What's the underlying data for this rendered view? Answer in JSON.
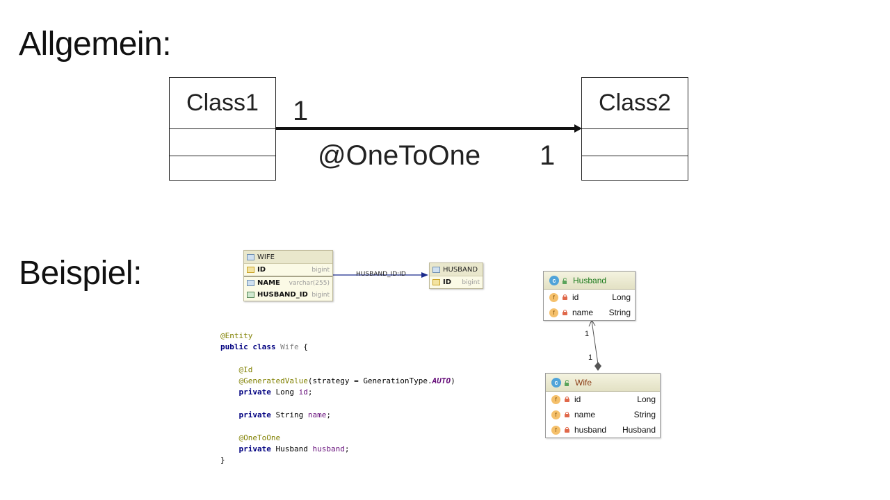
{
  "headings": {
    "general": "Allgemein:",
    "example": "Beispiel:"
  },
  "uml": {
    "class1": "Class1",
    "class2": "Class2",
    "mult_left": "1",
    "mult_right": "1",
    "relation": "@OneToOne"
  },
  "db": {
    "wife": {
      "title": "WIFE",
      "rows": [
        {
          "name": "ID",
          "type": "bigint"
        },
        {
          "name": "NAME",
          "type": "varchar(255)"
        },
        {
          "name": "HUSBAND_ID",
          "type": "bigint"
        }
      ]
    },
    "husband": {
      "title": "HUSBAND",
      "rows": [
        {
          "name": "ID",
          "type": "bigint"
        }
      ]
    },
    "fk_label": "HUSBAND_ID:ID"
  },
  "code_lines": [
    "@Entity",
    "public class Wife {",
    "",
    "    @Id",
    "    @GeneratedValue(strategy = GenerationType.AUTO)",
    "    private Long id;",
    "",
    "    private String name;",
    "",
    "    @OneToOne",
    "    private Husband husband;",
    "}"
  ],
  "class_diagram": {
    "husband": {
      "name": "Husband",
      "fields": [
        {
          "name": "id",
          "type": "Long"
        },
        {
          "name": "name",
          "type": "String"
        }
      ]
    },
    "wife": {
      "name": "Wife",
      "fields": [
        {
          "name": "id",
          "type": "Long"
        },
        {
          "name": "name",
          "type": "String"
        },
        {
          "name": "husband",
          "type": "Husband"
        }
      ]
    },
    "mult_top": "1",
    "mult_bottom": "1"
  },
  "colors": {
    "line": "#111111",
    "fk_line": "#1a2a8c",
    "husband_name": "#1c7a1c",
    "wife_name": "#8a3b12"
  }
}
